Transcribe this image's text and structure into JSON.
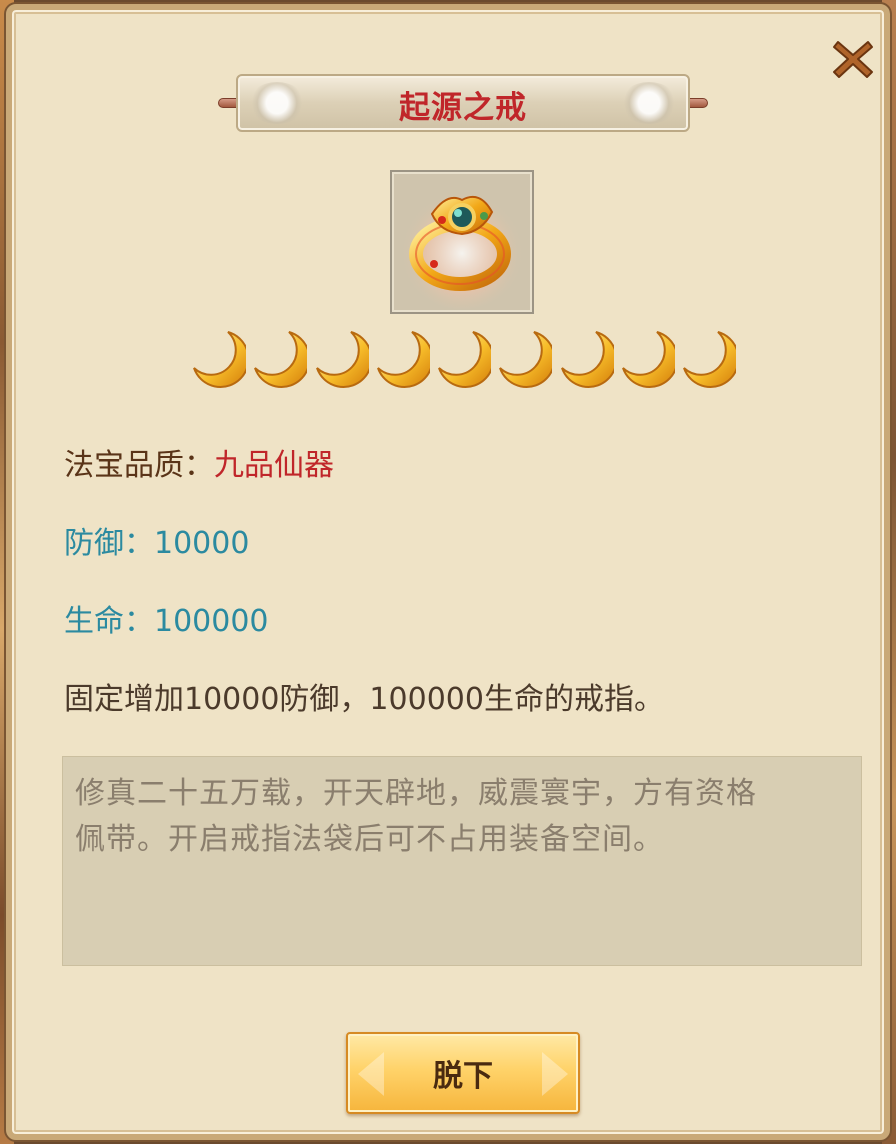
{
  "dialog": {
    "title": "起源之戒",
    "close_icon": "close-icon"
  },
  "item": {
    "icon": "golden-ring-icon",
    "star_count": 9,
    "star_icon": "crescent-moon-icon"
  },
  "stats": {
    "quality_label": "法宝品质：",
    "quality_value": "九品仙器",
    "defense_label": "防御：",
    "defense_value": "10000",
    "hp_label": "生命：",
    "hp_value": "100000",
    "description": "固定增加10000防御，100000生命的戒指。"
  },
  "lore": {
    "line1": "修真二十五万载，开天辟地，威震寰宇，方有资格",
    "line2": "佩带。开启戒指法袋后可不占用装备空间。"
  },
  "actions": {
    "remove_label": "脱下"
  },
  "colors": {
    "title": "#c0262a",
    "quality_value": "#c0262a",
    "stat": "#2b8aa0",
    "body_text": "#4b3a2b",
    "lore_text": "#8a7e6d",
    "button": "#ffd36a"
  }
}
